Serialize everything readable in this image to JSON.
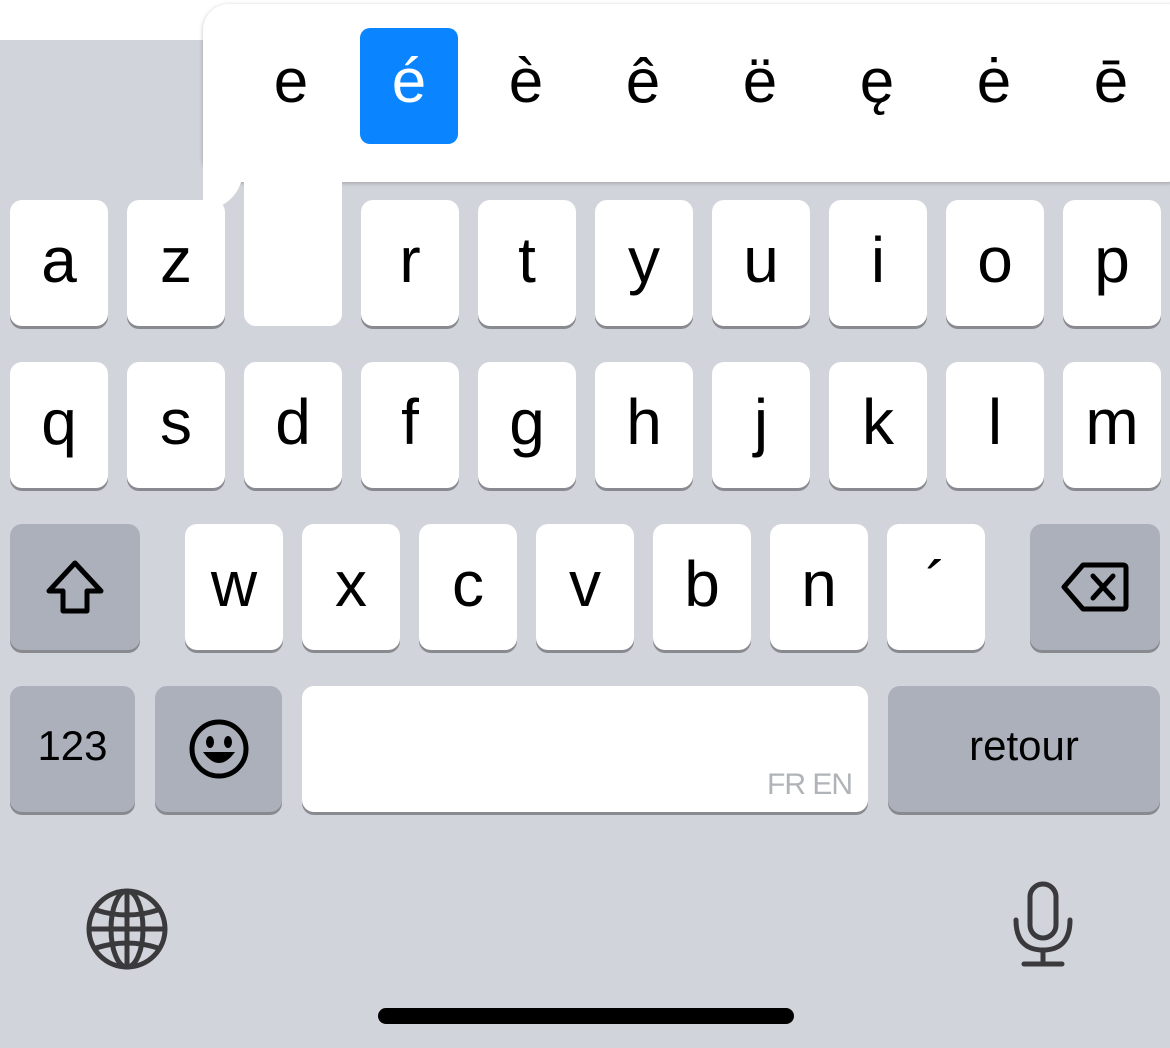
{
  "popup": {
    "variants": [
      "e",
      "é",
      "è",
      "ê",
      "ë",
      "ę",
      "ė",
      "ē"
    ],
    "selected": "é"
  },
  "rows": {
    "row1": [
      "a",
      "z",
      "",
      "r",
      "t",
      "y",
      "u",
      "i",
      "o",
      "p"
    ],
    "row2": [
      "q",
      "s",
      "d",
      "f",
      "g",
      "h",
      "j",
      "k",
      "l",
      "m"
    ],
    "row3": [
      "w",
      "x",
      "c",
      "v",
      "b",
      "n",
      "´"
    ]
  },
  "bottom": {
    "numbers_label": "123",
    "return_label": "retour",
    "space_lang_hint": "FR EN"
  },
  "icons": {
    "shift": "shift-icon",
    "delete": "delete-icon",
    "emoji": "emoji-icon",
    "globe": "globe-icon",
    "mic": "microphone-icon"
  },
  "colors": {
    "keyboard_bg": "#d1d4da",
    "key_bg": "#ffffff",
    "special_key_bg": "#abb0ba",
    "accent": "#0a84ff"
  }
}
